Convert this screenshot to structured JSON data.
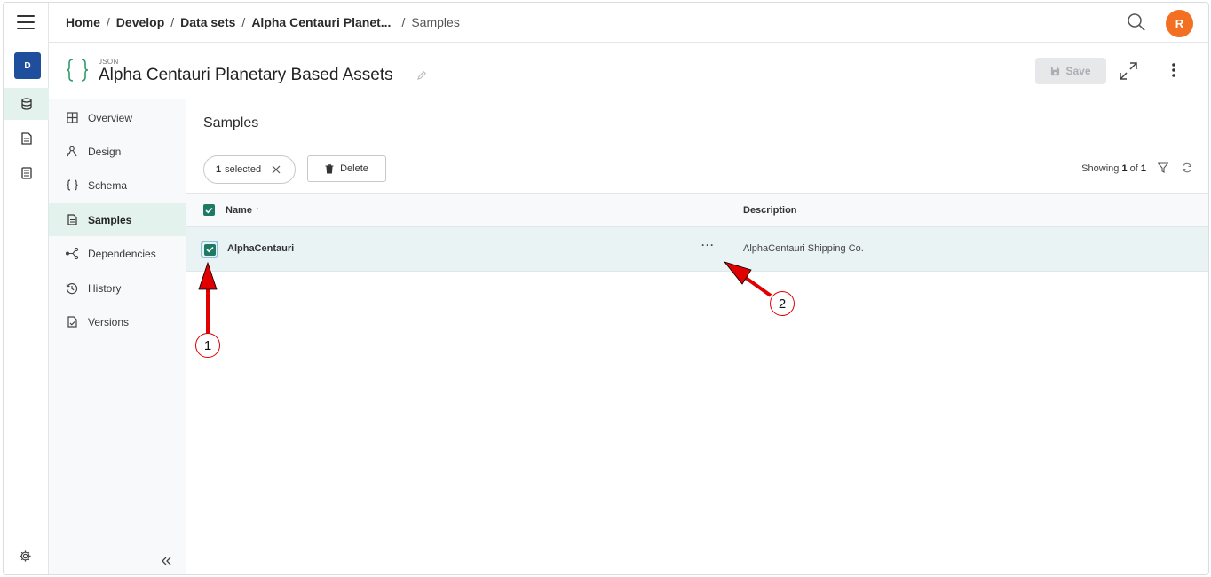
{
  "rail": {
    "tenant_initial": "D",
    "icons": [
      "menu-icon",
      "database-icon",
      "document-icon",
      "list-document-icon",
      "settings-icon"
    ]
  },
  "topbar": {
    "breadcrumbs": [
      "Home",
      "Develop",
      "Data sets",
      "Alpha Centauri Planet...",
      "Samples"
    ],
    "separator": "/",
    "avatar_initial": "R"
  },
  "titlebar": {
    "kind": "JSON",
    "title": "Alpha Centauri Planetary Based Assets",
    "save_label": "Save"
  },
  "subnav": {
    "items": [
      {
        "label": "Overview",
        "icon": "grid-icon"
      },
      {
        "label": "Design",
        "icon": "design-icon"
      },
      {
        "label": "Schema",
        "icon": "braces-icon"
      },
      {
        "label": "Samples",
        "icon": "document-icon",
        "active": true
      },
      {
        "label": "Dependencies",
        "icon": "dependencies-icon"
      },
      {
        "label": "History",
        "icon": "history-icon"
      },
      {
        "label": "Versions",
        "icon": "versions-icon"
      }
    ]
  },
  "content": {
    "heading": "Samples",
    "selected_count": "1",
    "selected_label": "selected",
    "delete_label": "Delete",
    "showing_prefix": "Showing",
    "showing_current": "1",
    "showing_of": "of",
    "showing_total": "1",
    "columns": {
      "name": "Name",
      "name_sort": "↑",
      "description": "Description"
    },
    "rows": [
      {
        "name": "AlphaCentauri",
        "more": "···",
        "description": "AlphaCentauri Shipping Co.",
        "checked": true
      }
    ]
  },
  "annotations": [
    "1",
    "2"
  ],
  "colors": {
    "accent": "#1f7a64",
    "tenant": "#1f4f9c",
    "avatar": "#f36f21",
    "callout": "#e00000"
  }
}
